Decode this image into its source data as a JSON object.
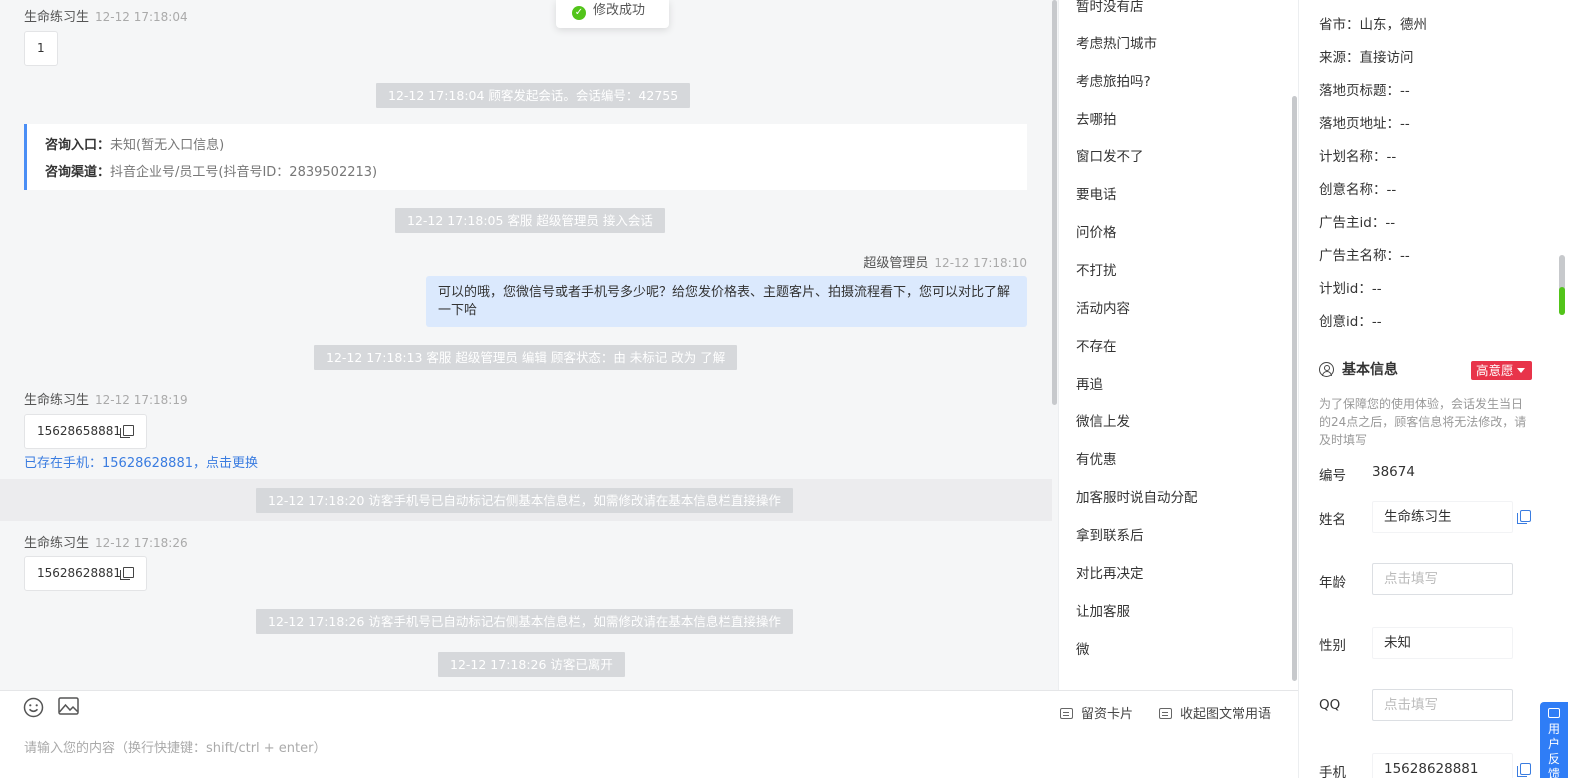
{
  "toast": "修改成功",
  "chat": {
    "m1": {
      "name": "生命练习生",
      "time": "12-12 17:18:04",
      "text": "1"
    },
    "sys1": "12-12 17:18:04 顾客发起会话。会话编号：42755",
    "consult": {
      "entry_label": "咨询入口：",
      "entry_value": "未知(暂无入口信息)",
      "channel_label": "咨询渠道：",
      "channel_value": "抖音企业号/员工号(抖音号ID：2839502213)"
    },
    "sys2": "12-12 17:18:05 客服 超级管理员 接入会话",
    "agent": {
      "name": "超级管理员",
      "time": "12-12 17:18:10",
      "text": "可以的哦，您微信号或者手机号多少呢？给您发价格表、主题客片、拍摄流程看下，您可以对比了解一下哈"
    },
    "sys3": "12-12 17:18:13 客服 超级管理员 编辑 顾客状态：由 未标记 改为 了解",
    "m2": {
      "name": "生命练习生",
      "time": "12-12 17:18:19",
      "text": "15628658881"
    },
    "phone_notice": "已存在手机：15628628881，点击更换",
    "sys4": "12-12 17:18:20 访客手机号已自动标记右侧基本信息栏，如需修改请在基本信息栏直接操作",
    "m3": {
      "name": "生命练习生",
      "time": "12-12 17:18:26",
      "text": "15628628881"
    },
    "sys5": "12-12 17:18:26 访客手机号已自动标记右侧基本信息栏，如需修改请在基本信息栏直接操作",
    "sys6": "12-12 17:18:26 访客已离开"
  },
  "quick_replies": [
    "暂时没有店",
    "考虑热门城市",
    "考虑旅拍吗?",
    "去哪拍",
    "窗口发不了",
    "要电话",
    "问价格",
    "不打扰",
    "活动内容",
    "不存在",
    "再追",
    "微信上发",
    "有优惠",
    "加客服时说自动分配",
    "拿到联系后",
    "对比再决定",
    "让加客服",
    "微"
  ],
  "input": {
    "placeholder": "请输入您的内容（换行快捷键：shift/ctrl + enter）",
    "card_label": "留资卡片",
    "phrases_label": "收起图文常用语",
    "emoji_icon": "smile-icon",
    "image_icon": "image-icon"
  },
  "info": {
    "source_lines": [
      "省市：山东，德州",
      "来源：直接访问",
      "落地页标题：--",
      "落地页地址：--",
      "计划名称：--",
      "创意名称：--",
      "广告主id：--",
      "广告主名称：--",
      "计划id：--",
      "创意id：--"
    ],
    "section_title": "基本信息",
    "intent_badge": "高意愿",
    "note": "为了保障您的使用体验，会话发生当日的24点之后，顾客信息将无法修改，请及时填写",
    "id_label": "编号",
    "id_value": "38674",
    "name_label": "姓名",
    "name_value": "生命练习生",
    "age_label": "年龄",
    "age_placeholder": "点击填写",
    "gender_label": "性别",
    "gender_value": "未知",
    "qq_label": "QQ",
    "qq_placeholder": "点击填写",
    "phone_label": "手机",
    "phone_value": "15628628881"
  },
  "feedback": "用户反馈"
}
